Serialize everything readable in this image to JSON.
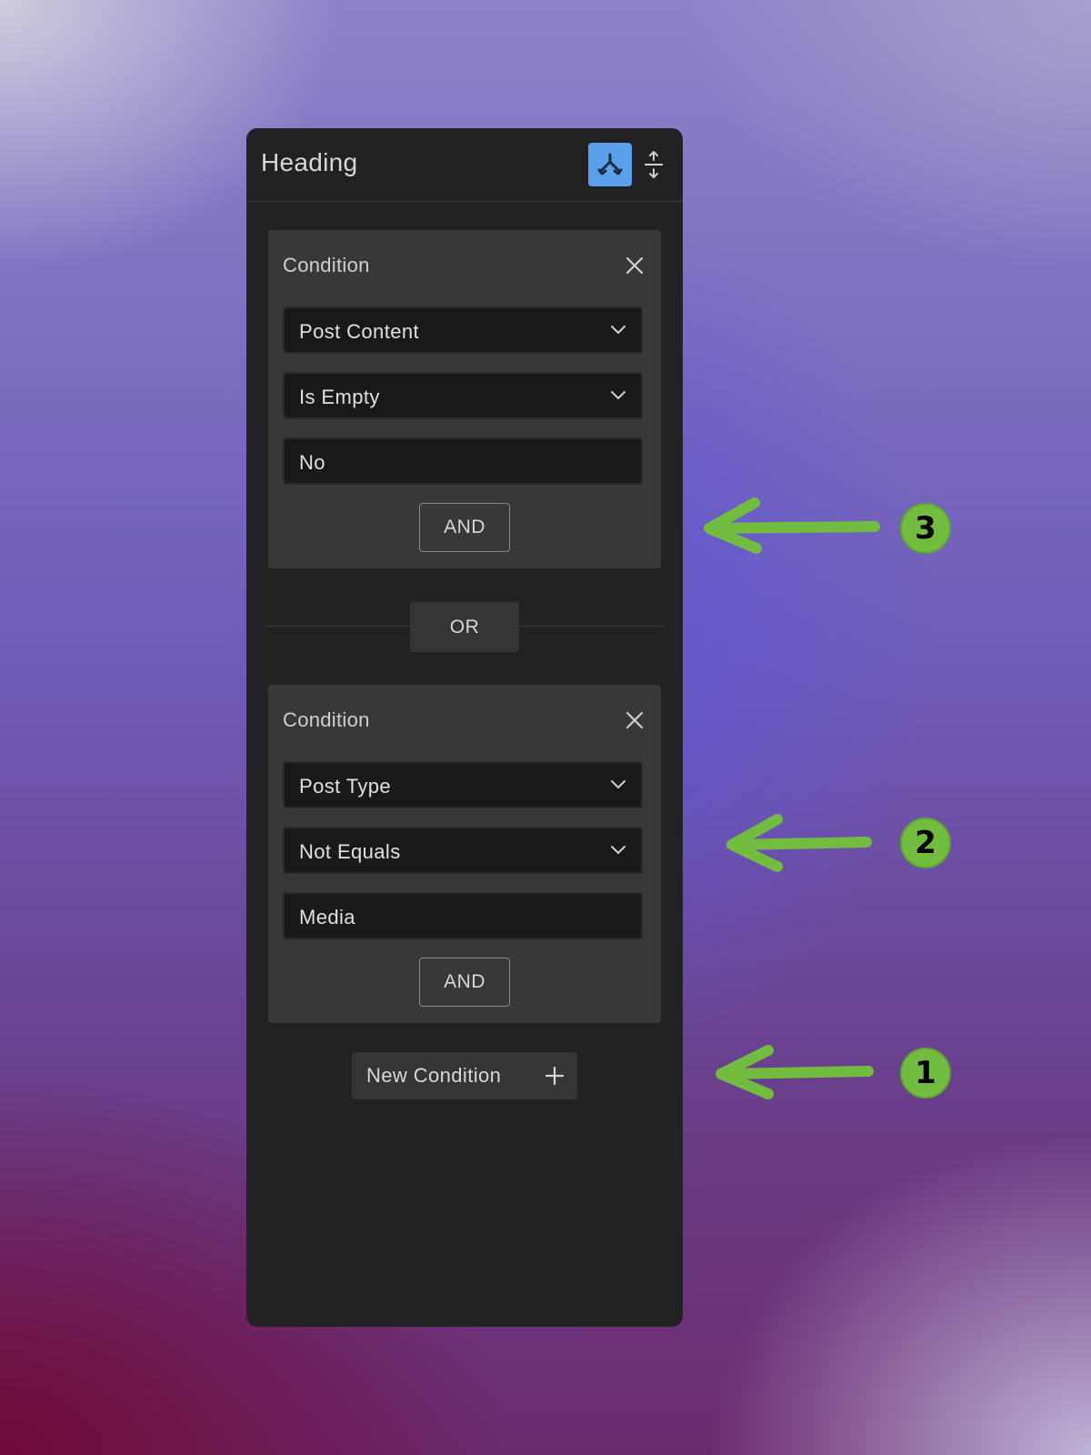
{
  "panel": {
    "title": "Heading",
    "header_buttons": [
      {
        "icon": "conditions-icon",
        "active": true,
        "accent": "#5aa0ea"
      },
      {
        "icon": "expand-vertical-icon",
        "active": false
      }
    ]
  },
  "conditions": [
    {
      "title": "Condition",
      "field": "Post Content",
      "operator": "Is Empty",
      "value": "No",
      "and_label": "AND"
    },
    {
      "title": "Condition",
      "field": "Post Type",
      "operator": "Not Equals",
      "value": "Media",
      "and_label": "AND"
    }
  ],
  "or_label": "OR",
  "new_condition_label": "New Condition",
  "annotations": [
    {
      "number": "3",
      "color": "#72bd3f"
    },
    {
      "number": "2",
      "color": "#72bd3f"
    },
    {
      "number": "1",
      "color": "#72bd3f"
    }
  ]
}
